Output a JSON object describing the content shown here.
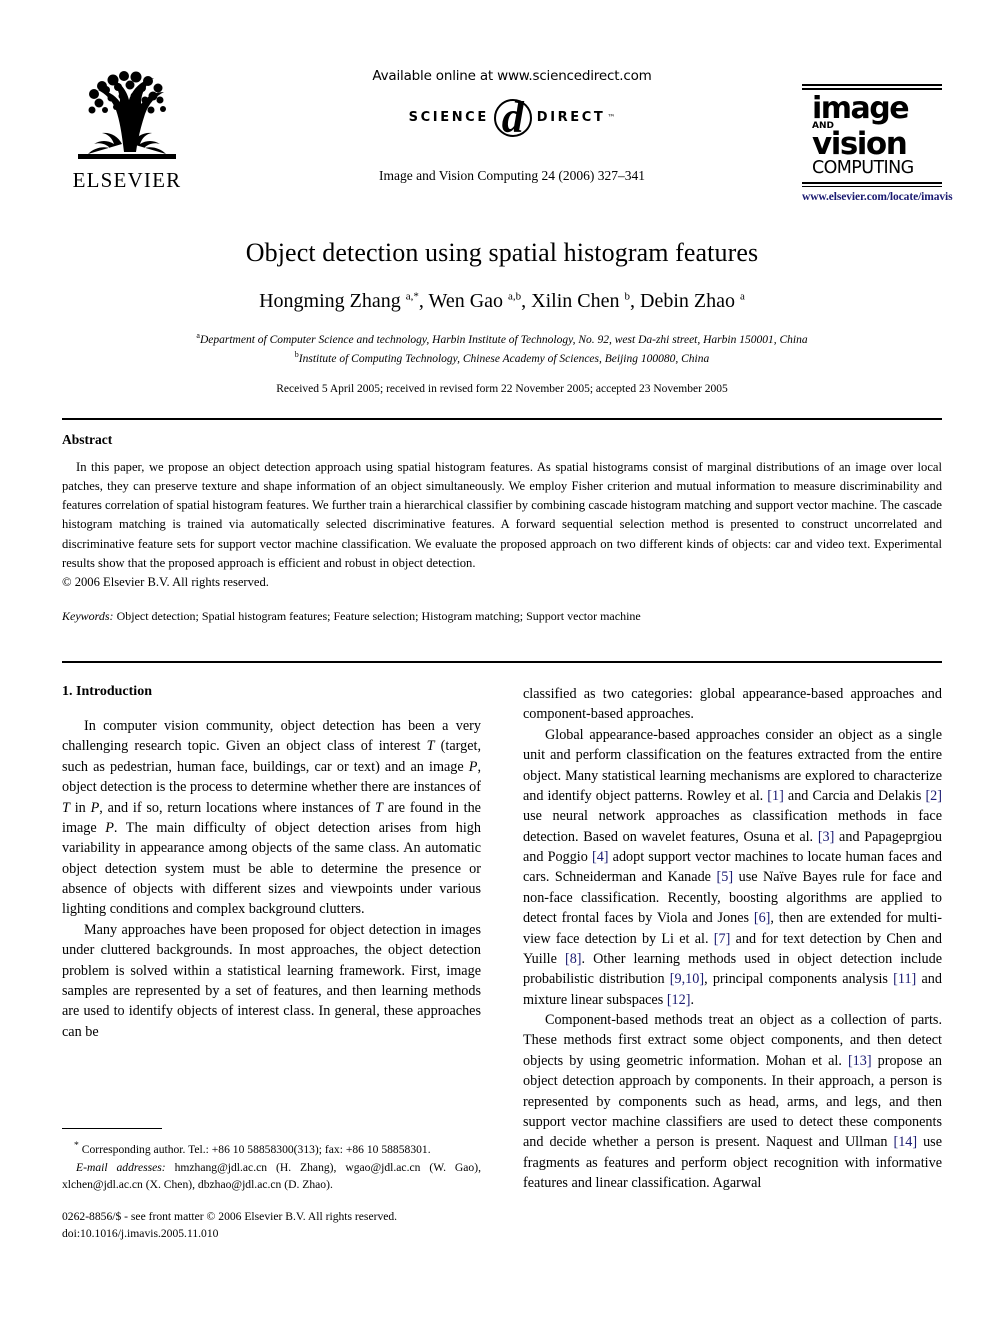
{
  "masthead": {
    "publisher_name": "ELSEVIER",
    "available_online": "Available online at www.sciencedirect.com",
    "sciencedirect": {
      "science": "SCIENCE",
      "d": "d",
      "direct": "DIRECT",
      "tm": "™"
    },
    "journal_ref": "Image and Vision Computing 24 (2006) 327–341",
    "journal_logo": {
      "line1": "image",
      "line2": "AND",
      "line3": "vision",
      "line4": "COMPUTING"
    },
    "journal_url": "www.elsevier.com/locate/imavis",
    "url_color": "#191970"
  },
  "title_block": {
    "title": "Object detection using spatial histogram features",
    "authors_html": "Hongming Zhang <sup>a,*</sup>, Wen Gao <sup>a,b</sup>, Xilin Chen <sup>b</sup>, Debin Zhao <sup>a</sup>",
    "affiliation_a": "Department of Computer Science and technology, Harbin Institute of Technology, No. 92, west Da-zhi street, Harbin 150001, China",
    "affiliation_b": "Institute of Computing Technology, Chinese Academy of Sciences, Beijing 100080, China",
    "affiliation_a_marker": "a",
    "affiliation_b_marker": "b",
    "received": "Received 5 April 2005; received in revised form 22 November 2005; accepted 23 November 2005"
  },
  "abstract": {
    "heading": "Abstract",
    "text": "In this paper, we propose an object detection approach using spatial histogram features. As spatial histograms consist of marginal distributions of an image over local patches, they can preserve texture and shape information of an object simultaneously. We employ Fisher criterion and mutual information to measure discriminability and features correlation of spatial histogram features. We further train a hierarchical classifier by combining cascade histogram matching and support vector machine. The cascade histogram matching is trained via automatically selected discriminative features. A forward sequential selection method is presented to construct uncorrelated and discriminative feature sets for support vector machine classification. We evaluate the proposed approach on two different kinds of objects: car and video text. Experimental results show that the proposed approach is efficient and robust in object detection.",
    "copyright": "© 2006 Elsevier B.V. All rights reserved.",
    "keywords_label": "Keywords:",
    "keywords_value": "Object detection; Spatial histogram features; Feature selection; Histogram matching; Support vector machine"
  },
  "body": {
    "section1_heading": "1. Introduction",
    "left_paragraphs": [
      {
        "indent": true,
        "parts": [
          {
            "t": "In computer vision community, object detection has been a very challenging research topic. Given an object class of interest "
          },
          {
            "t": "T",
            "style": "italic"
          },
          {
            "t": " (target, such as pedestrian, human face, buildings, car or text) and an image "
          },
          {
            "t": "P",
            "style": "italic"
          },
          {
            "t": ", object detection is the process to determine whether there are instances of "
          },
          {
            "t": "T",
            "style": "italic"
          },
          {
            "t": " in "
          },
          {
            "t": "P",
            "style": "italic"
          },
          {
            "t": ", and if so, return locations where instances of "
          },
          {
            "t": "T",
            "style": "italic"
          },
          {
            "t": " are found in the image "
          },
          {
            "t": "P",
            "style": "italic"
          },
          {
            "t": ". The main difficulty of object detection arises from high variability in appearance among objects of the same class. An automatic object detection system must be able to determine the presence or absence of objects with different sizes and viewpoints under various lighting conditions and complex background clutters."
          }
        ]
      },
      {
        "indent": true,
        "parts": [
          {
            "t": "Many approaches have been proposed for object detection in images under cluttered backgrounds. In most approaches, the object detection problem is solved within a statistical learning framework. First, image samples are represented by a set of features, and then learning methods are used to identify objects of interest class. In general, these approaches can be"
          }
        ]
      }
    ],
    "right_paragraphs": [
      {
        "indent": false,
        "parts": [
          {
            "t": "classified as two categories: global appearance-based approaches and component-based approaches."
          }
        ]
      },
      {
        "indent": true,
        "parts": [
          {
            "t": "Global appearance-based approaches consider an object as a single unit and perform classification on the features extracted from the entire object. Many statistical learning mechanisms are explored to characterize and identify object patterns. Rowley et al. "
          },
          {
            "t": "[1]",
            "style": "cite"
          },
          {
            "t": " and Carcia and Delakis "
          },
          {
            "t": "[2]",
            "style": "cite"
          },
          {
            "t": " use neural network approaches as classification methods in face detection. Based on wavelet features, Osuna et al. "
          },
          {
            "t": "[3]",
            "style": "cite"
          },
          {
            "t": " and Papageprgiou and Poggio "
          },
          {
            "t": "[4]",
            "style": "cite"
          },
          {
            "t": " adopt support vector machines to locate human faces and cars. Schneiderman and Kanade "
          },
          {
            "t": "[5]",
            "style": "cite"
          },
          {
            "t": " use Naïve Bayes rule for face and non-face classification. Recently, boosting algorithms are applied to detect frontal faces by Viola and Jones "
          },
          {
            "t": "[6]",
            "style": "cite"
          },
          {
            "t": ", then are extended for multi-view face detection by Li et al. "
          },
          {
            "t": "[7]",
            "style": "cite"
          },
          {
            "t": " and for text detection by Chen and Yuille "
          },
          {
            "t": "[8]",
            "style": "cite"
          },
          {
            "t": ". Other learning methods used in object detection include probabilistic distribution "
          },
          {
            "t": "[9,10]",
            "style": "cite"
          },
          {
            "t": ", principal components analysis "
          },
          {
            "t": "[11]",
            "style": "cite"
          },
          {
            "t": " and mixture linear subspaces "
          },
          {
            "t": "[12]",
            "style": "cite"
          },
          {
            "t": "."
          }
        ]
      },
      {
        "indent": true,
        "parts": [
          {
            "t": "Component-based methods treat an object as a collection of parts. These methods first extract some object components, and then detect objects by using geometric information. Mohan et al. "
          },
          {
            "t": "[13]",
            "style": "cite"
          },
          {
            "t": " propose an object detection approach by components. In their approach, a person is represented by components such as head, arms, and legs, and then support vector machine classifiers are used to detect these components and decide whether a person is present. Naquest and Ullman "
          },
          {
            "t": "[14]",
            "style": "cite"
          },
          {
            "t": " use fragments as features and perform object recognition with informative features and linear classification. Agarwal"
          }
        ]
      }
    ]
  },
  "footnote": {
    "corresponding_marker": "*",
    "corresponding_text": "Corresponding author. Tel.: +86 10 58858300(313); fax: +86 10 58858301.",
    "email_label": "E-mail addresses:",
    "email_text": "hmzhang@jdl.ac.cn (H. Zhang), wgao@jdl.ac.cn (W. Gao), xlchen@jdl.ac.cn (X. Chen), dbzhao@jdl.ac.cn (D. Zhao).",
    "imprint_line1": "0262-8856/$ - see front matter © 2006 Elsevier B.V. All rights reserved.",
    "imprint_line2": "doi:10.1016/j.imavis.2005.11.010"
  }
}
